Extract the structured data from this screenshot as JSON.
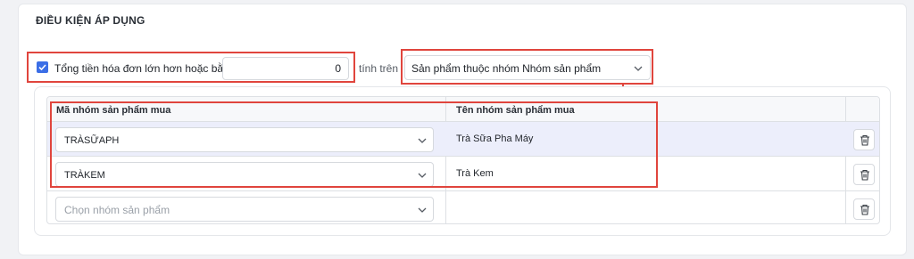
{
  "section": {
    "title": "ĐIỀU KIỆN ÁP DỤNG"
  },
  "condition": {
    "checked": true,
    "label": "Tổng tiền hóa đơn lớn hơn hoặc bằng",
    "amount": "0",
    "connector": "tính trên",
    "scope_value": "Sản phẩm thuộc nhóm Nhóm sản phẩm"
  },
  "table": {
    "columns": [
      "Mã nhóm sản phẩm mua",
      "Tên nhóm sản phẩm mua",
      ""
    ],
    "rows": [
      {
        "code": "TRÀSỮAPH",
        "name": "Trà Sữa Pha Máy",
        "highlighted": true
      },
      {
        "code": "TRÀKEM",
        "name": "Trà Kem",
        "highlighted": false
      }
    ],
    "new_row_placeholder": "Chọn nhóm sản phẩm"
  },
  "colors": {
    "accent": "#3b6ee6",
    "annotation": "#e0453d",
    "row_highlight": "#eceefb"
  },
  "icons": {
    "checkbox": "check-icon",
    "dropdown": "chevron-down-icon",
    "delete": "trash-icon",
    "annotation": "arrow-down-icon"
  }
}
